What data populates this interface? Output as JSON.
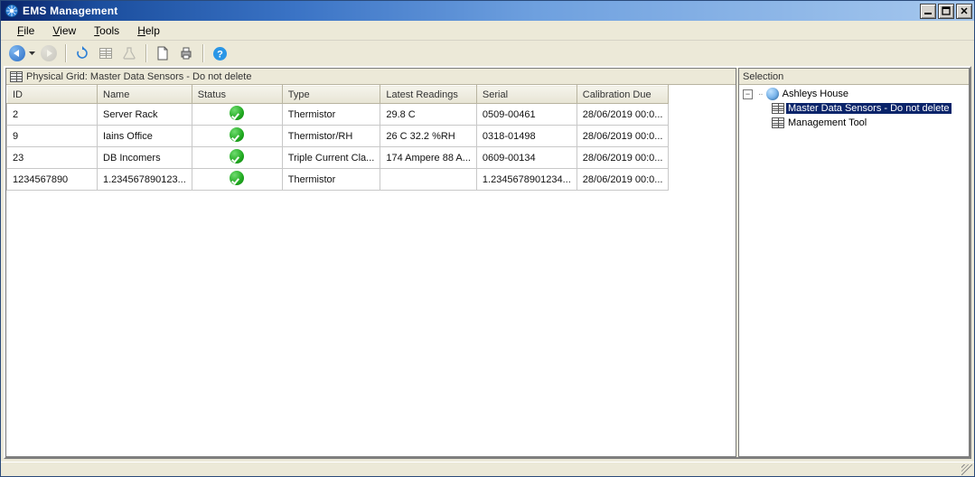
{
  "window": {
    "title": "EMS Management"
  },
  "menu": {
    "file": "File",
    "view": "View",
    "tools": "Tools",
    "help": "Help"
  },
  "toolbar": {
    "icons": {
      "back": "nav-back-icon",
      "forward": "nav-forward-icon",
      "refresh": "refresh-icon",
      "save_grid": "save-grid-icon",
      "beaker": "flask-icon",
      "page": "page-icon",
      "print": "print-icon",
      "help": "help-icon"
    }
  },
  "left": {
    "header": "Physical Grid:  Master Data Sensors - Do not delete"
  },
  "columns": {
    "id": "ID",
    "name": "Name",
    "status": "Status",
    "type": "Type",
    "latest": "Latest Readings",
    "serial": "Serial",
    "cal": "Calibration Due"
  },
  "rows": [
    {
      "id": "2",
      "name": "Server Rack",
      "status": "ok",
      "type": "Thermistor",
      "latest": "29.8 C",
      "serial": "0509-00461",
      "cal": "28/06/2019 00:0..."
    },
    {
      "id": "9",
      "name": "Iains Office",
      "status": "ok",
      "type": "Thermistor/RH",
      "latest": "26 C 32.2 %RH",
      "serial": "0318-01498",
      "cal": "28/06/2019 00:0..."
    },
    {
      "id": "23",
      "name": "DB Incomers",
      "status": "ok",
      "type": "Triple Current Cla...",
      "latest": "174 Ampere 88 A...",
      "serial": "0609-00134",
      "cal": "28/06/2019 00:0..."
    },
    {
      "id": "1234567890",
      "name": "1.234567890123...",
      "status": "ok",
      "type": "Thermistor",
      "latest": "",
      "serial": "1.2345678901234...",
      "cal": "28/06/2019 00:0..."
    }
  ],
  "right": {
    "header": "Selection"
  },
  "tree": {
    "root": "Ashleys House",
    "children": [
      {
        "label": "Master Data Sensors - Do not delete",
        "selected": true
      },
      {
        "label": "Management Tool",
        "selected": false
      }
    ]
  }
}
